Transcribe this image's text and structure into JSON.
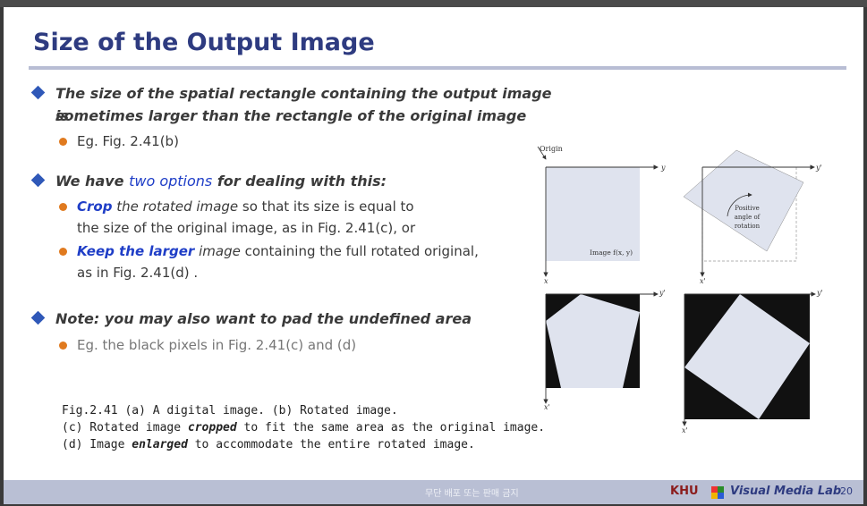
{
  "slide": {
    "title": "Size of the Output Image",
    "bullets": [
      {
        "line1": "The size of the spatial rectangle containing the output image is",
        "line2": "sometimes larger than the rectangle of the original image",
        "sub": [
          {
            "text": "Eg. Fig. 2.41(b)"
          }
        ]
      },
      {
        "pre": "We have ",
        "emph": "two options",
        "post": " for dealing with this:",
        "sub": [
          {
            "emph": "Crop",
            "it": " the rotated image",
            "rest": " so that its size is equal to",
            "line2": "the size of the original image, as in Fig. 2.41(c), or"
          },
          {
            "emph": "Keep the larger",
            "it": " image",
            "rest": " containing the full rotated original,",
            "line2": "as in Fig. 2.41(d) ."
          }
        ]
      },
      {
        "line1": "Note: you may also want to pad the undefined area",
        "sub": [
          {
            "text": "Eg. the black pixels in Fig. 2.41(c) and (d)"
          }
        ]
      }
    ],
    "caption": {
      "l1": "Fig.2.41 (a) A digital image. (b) Rotated image.",
      "l2a": "(c) Rotated image ",
      "l2b": "cropped",
      "l2c": " to fit the same area as the original image.",
      "l3a": "(d) Image ",
      "l3b": "enlarged",
      "l3c": " to accommodate the entire rotated image."
    },
    "figure": {
      "origin": "Origin",
      "image_label": "Image f(x, y)",
      "rotation_label": [
        "Positive",
        "angle of",
        "rotation"
      ],
      "y": "y",
      "x": "x",
      "yp": "y'",
      "xp": "x'"
    }
  },
  "footer": {
    "notice": "무단 배포 또는 판매 금지",
    "khu": "KHU",
    "lab": "Visual Media Lab",
    "page": "20"
  },
  "colors": {
    "title": "#2e3b80",
    "accent_blue": "#1f3ec7",
    "diamond": "#2f58b8",
    "dot": "#e07a1f",
    "footer_bg": "#b9bfd4",
    "image_fill": "#dfe3ee"
  }
}
